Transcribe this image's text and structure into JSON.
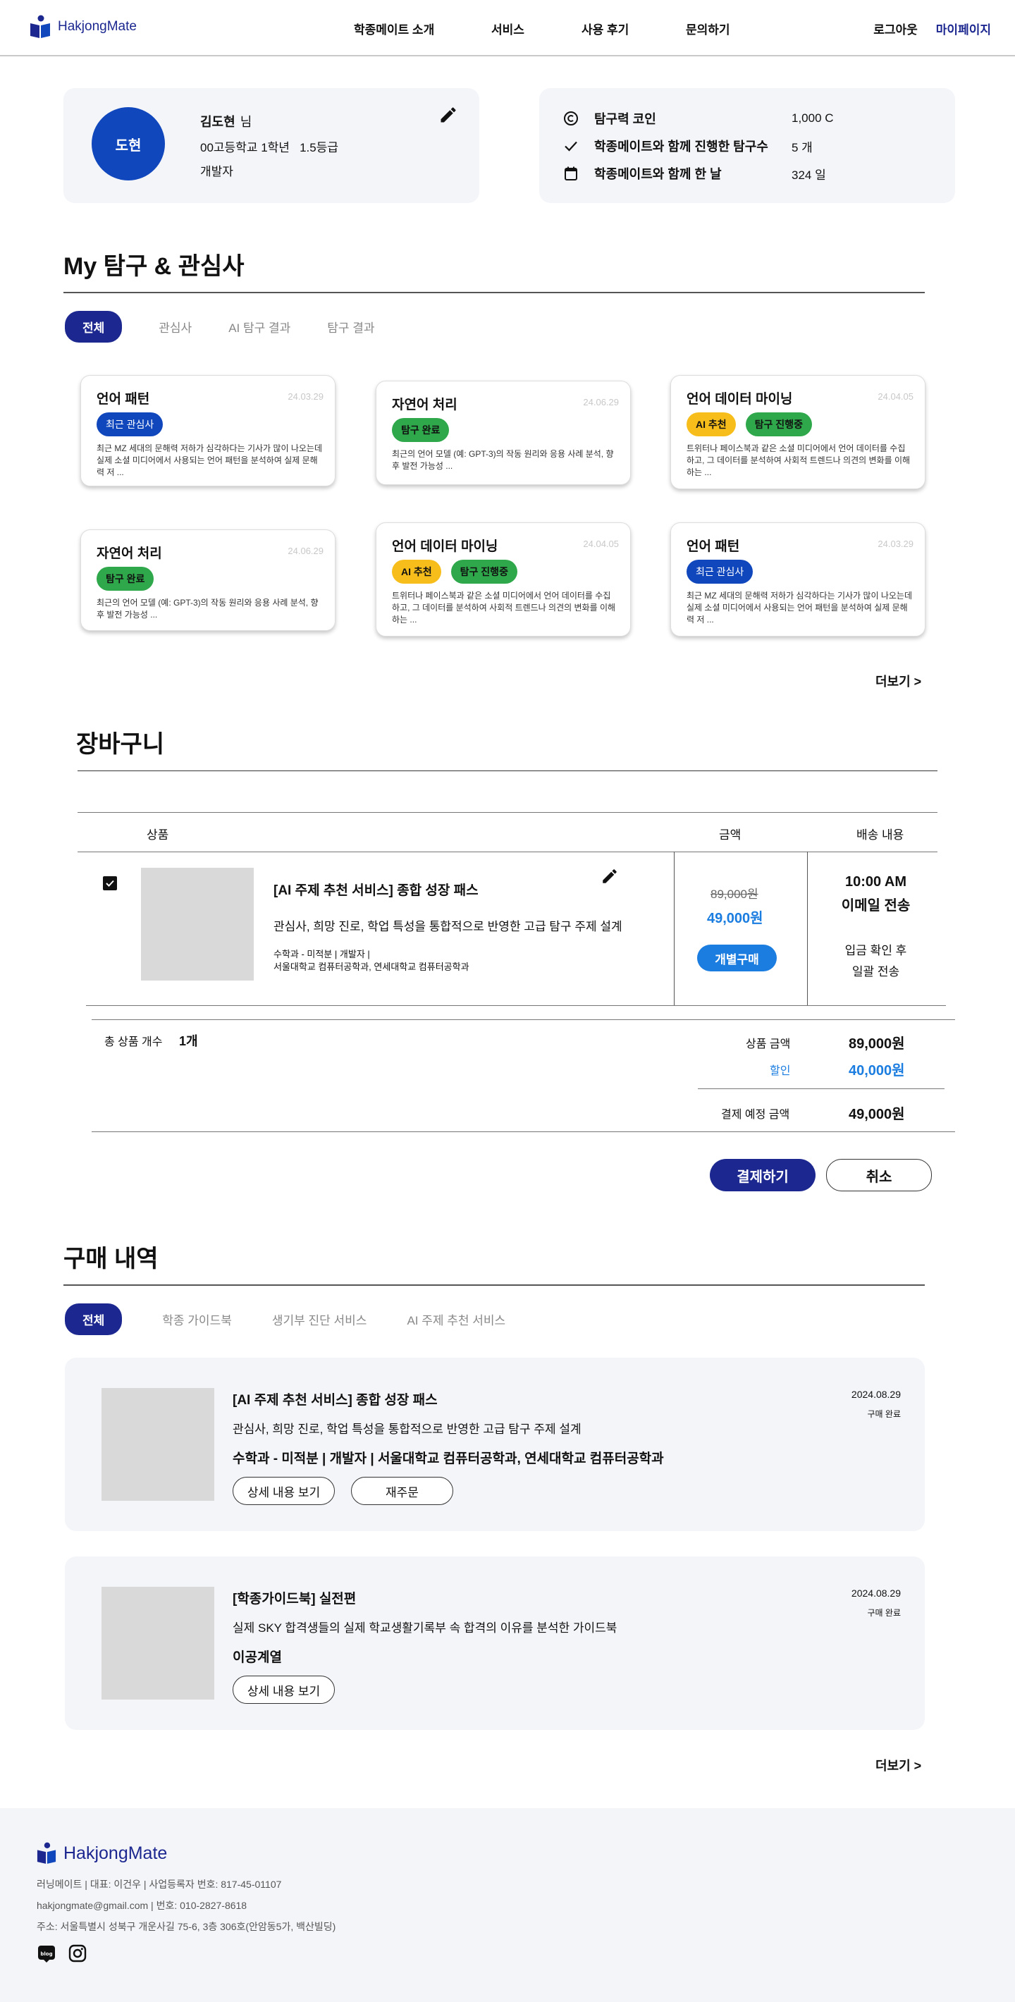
{
  "header": {
    "logo": "HakjongMate",
    "nav": [
      "학종메이트 소개",
      "서비스",
      "사용 후기",
      "문의하기"
    ],
    "logout": "로그아웃",
    "mypage": "마이페이지"
  },
  "profile": {
    "avatar": "도현",
    "name": "김도현",
    "honorific": "님",
    "school": "00고등학교 1학년   1.5등급",
    "job": "개발자"
  },
  "stats": [
    {
      "icon": "copyright-icon",
      "label": "탐구력 코인",
      "value": "1,000 C"
    },
    {
      "icon": "check-icon",
      "label": "학종메이트와 함께 진행한 탐구수",
      "value": "5 개"
    },
    {
      "icon": "calendar-icon",
      "label": "학종메이트와 함께 한 날",
      "value": "324 일"
    }
  ],
  "interests": {
    "title": "My 탐구 & 관심사",
    "tabs": [
      "전체",
      "관심사",
      "AI 탐구 결과",
      "탐구 결과"
    ],
    "cards": [
      {
        "title": "언어 패턴",
        "date": "24.03.29",
        "tags": [
          {
            "text": "최근 관심사",
            "color": "blue"
          }
        ],
        "desc": "최근 MZ 세대의 문해력 저하가 심각하다는 기사가 많이 나오는데 실제 소셜 미디어에서 사용되는 언어 패턴을 분석하여 실제 문해력 저 ..."
      },
      {
        "title": "자연어 처리",
        "date": "24.06.29",
        "tags": [
          {
            "text": "탐구 완료",
            "color": "green"
          }
        ],
        "desc": "최근의 언어 모델 (예: GPT-3)의 작동 원리와 응용 사례 분석, 향후 발전 가능성 ..."
      },
      {
        "title": "언어 데이터 마이닝",
        "date": "24.04.05",
        "tags": [
          {
            "text": "AI 추천",
            "color": "yellow"
          },
          {
            "text": "탐구 진행중",
            "color": "green"
          }
        ],
        "desc": "트위터나 페이스북과 같은 소셜 미디어에서 언어 데이터를 수집하고, 그 데이터를 분석하여 사회적 트렌드나 의견의 변화를 이해하는 ..."
      },
      {
        "title": "자연어 처리",
        "date": "24.06.29",
        "tags": [
          {
            "text": "탐구 완료",
            "color": "green"
          }
        ],
        "desc": "최근의 언어 모델 (예: GPT-3)의 작동 원리와 응용 사례 분석, 향후 발전 가능성 ..."
      },
      {
        "title": "언어 데이터 마이닝",
        "date": "24.04.05",
        "tags": [
          {
            "text": "AI 추천",
            "color": "yellow"
          },
          {
            "text": "탐구 진행중",
            "color": "green"
          }
        ],
        "desc": "트위터나 페이스북과 같은 소셜 미디어에서 언어 데이터를 수집하고, 그 데이터를 분석하여 사회적 트렌드나 의견의 변화를 이해하는 ..."
      },
      {
        "title": "언어 패턴",
        "date": "24.03.29",
        "tags": [
          {
            "text": "최근 관심사",
            "color": "blue"
          }
        ],
        "desc": "최근 MZ 세대의 문해력 저하가 심각하다는 기사가 많이 나오는데 실제 소셜 미디어에서 사용되는 언어 패턴을 분석하여 실제 문해력 저 ..."
      }
    ],
    "more": "더보기 >"
  },
  "cart": {
    "title": "장바구니",
    "col_product": "상품",
    "col_price": "금액",
    "col_delivery": "배송 내용",
    "item": {
      "title": "[AI 주제 추천 서비스] 종합 성장 패스",
      "desc": "관심사, 희망 진로, 학업 특성을 통합적으로 반영한 고급 탐구 주제 설계",
      "meta1": "수학과 - 미적분 | 개발자 |",
      "meta2": "서울대학교 컴퓨터공학과, 연세대학교 컴퓨터공학과",
      "old_price": "89,000원",
      "new_price": "49,000원",
      "buy_button": "개별구매",
      "delivery_time": "10:00 AM",
      "delivery_method": "이메일 전송",
      "delivery_note1": "입금 확인 후",
      "delivery_note2": "일괄 전송"
    },
    "total_count_label": "총 상품 개수",
    "total_count": "1개",
    "product_amount_label": "상품 금액",
    "product_amount": "89,000원",
    "discount_label": "할인",
    "discount": "40,000원",
    "pay_amount_label": "결제 예정 금액",
    "pay_amount": "49,000원",
    "pay_button": "결제하기",
    "cancel_button": "취소"
  },
  "purchases": {
    "title": "구매 내역",
    "tabs": [
      "전체",
      "학종 가이드북",
      "생기부 진단 서비스",
      "AI 주제 추천 서비스"
    ],
    "items": [
      {
        "title": "[AI 주제 추천 서비스] 종합 성장 패스",
        "desc": "관심사, 희망 진로, 학업 특성을 통합적으로 반영한 고급 탐구 주제 설계",
        "meta": "수학과 - 미적분 | 개발자 | 서울대학교 컴퓨터공학과, 연세대학교 컴퓨터공학과",
        "date": "2024.08.29",
        "status": "구매 완료",
        "detail_button": "상세 내용 보기",
        "reorder_button": "재주문"
      },
      {
        "title": "[학종가이드북] 실전편",
        "desc": "실제 SKY 합격생들의 실제 학교생활기록부 속 합격의 이유를 분석한 가이드북",
        "meta": "이공계열",
        "date": "2024.08.29",
        "status": "구매 완료",
        "detail_button": "상세 내용 보기"
      }
    ],
    "more": "더보기 >"
  },
  "footer": {
    "logo": "HakjongMate",
    "line1": "러닝메이트 | 대표: 이건우 | 사업등록자 번호: 817-45-01107",
    "line2": "hakjongmate@gmail.com | 번호: 010-2827-8618",
    "line3": "주소: 서울특별시 성북구 개운사길 75-6, 3층 306호(안암동5가, 백산빌딩)",
    "blog_icon_text": "blog"
  },
  "colors": {
    "navy": "#1c2890",
    "blue": "#1047bd",
    "sky": "#1b7de0",
    "green": "#2ea84a",
    "yellow": "#f7be1b",
    "card_bg": "#f4f5f9"
  }
}
